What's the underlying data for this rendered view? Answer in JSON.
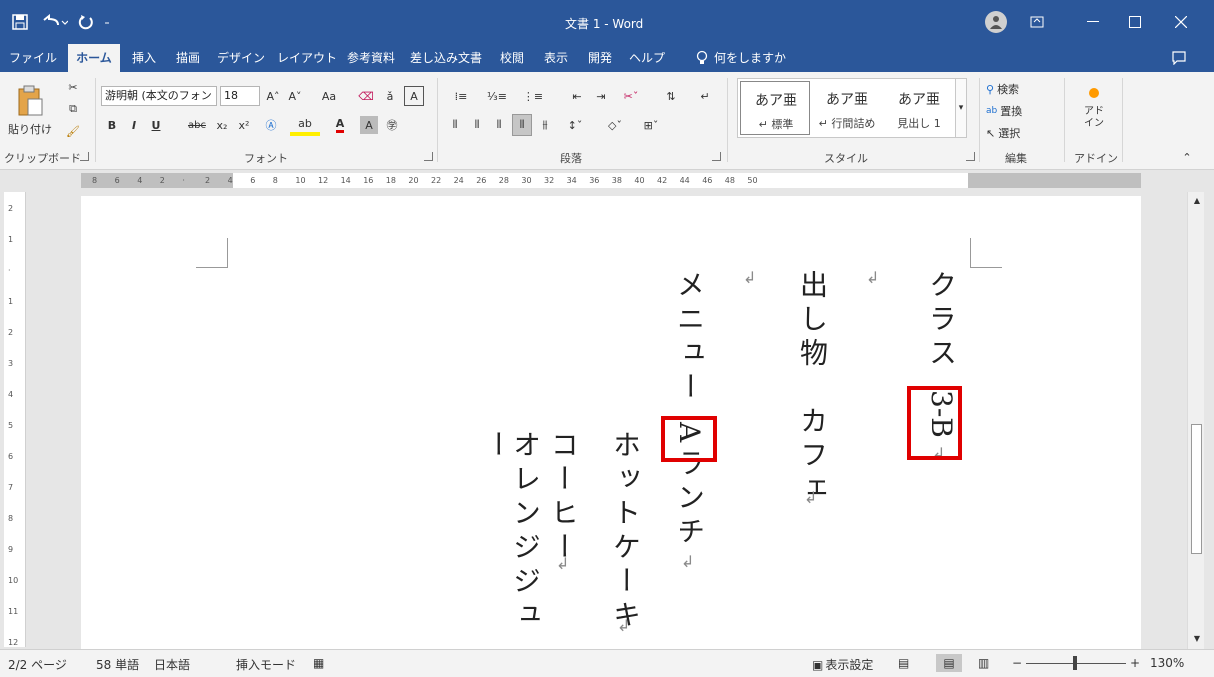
{
  "window": {
    "title": "文書 1  -  Word",
    "tell_me": "何をしますか"
  },
  "tabs": [
    "ファイル",
    "ホーム",
    "挿入",
    "描画",
    "デザイン",
    "レイアウト",
    "参考資料",
    "差し込み文書",
    "校閲",
    "表示",
    "開発",
    "ヘルプ"
  ],
  "ribbon": {
    "clipboard": {
      "paste": "貼り付け",
      "group": "クリップボード"
    },
    "font": {
      "name": "游明朝 (本文のフォン",
      "size": "18",
      "change_case": "Aa",
      "group": "フォント",
      "bold": "B",
      "italic": "I",
      "underline": "U",
      "strike": "abc",
      "sub": "x₂",
      "sup": "x²",
      "color_letter": "A"
    },
    "paragraph": {
      "group": "段落"
    },
    "styles": {
      "items": [
        {
          "main": "あア亜",
          "sub": "↵ 標準"
        },
        {
          "main": "あア亜",
          "sub": "↵ 行間詰め"
        },
        {
          "main": "あア亜",
          "sub": "見出し 1"
        }
      ],
      "group": "スタイル"
    },
    "editing": {
      "search": "検索",
      "replace": "置換",
      "select": "選択",
      "group": "編集"
    },
    "addins": {
      "label": "アド\nイン",
      "group": "アドイン"
    }
  },
  "ruler": {
    "ticks": [
      "8",
      "6",
      "4",
      "2",
      "",
      "2",
      "4",
      "6",
      "8",
      "10",
      "12",
      "14",
      "16",
      "18",
      "20",
      "22",
      "24",
      "26",
      "28",
      "30",
      "32",
      "34",
      "36",
      "38",
      "40",
      "42",
      "44",
      "46",
      "48",
      "50"
    ]
  },
  "vruler": {
    "ticks": [
      "2",
      "1",
      "",
      "1",
      "2",
      "3",
      "4",
      "5",
      "6",
      "7",
      "8",
      "9",
      "10",
      "11",
      "12"
    ]
  },
  "document": {
    "columns": [
      {
        "text": "クラス"
      },
      {
        "text": "3-B"
      },
      {
        "text": "出し物　カフェ"
      },
      {
        "text": "メニュー"
      },
      {
        "text": "Aランチ"
      },
      {
        "text": "ホットケーキ"
      },
      {
        "text": "コーヒー"
      },
      {
        "text": "オレンジジュー"
      }
    ]
  },
  "status": {
    "page": "2/2 ページ",
    "words": "58 単語",
    "lang": "日本語",
    "mode": "挿入モード",
    "display": "表示設定",
    "zoom": "130%"
  },
  "colors": {
    "accent": "#2b579a",
    "highlight": "#e00000"
  }
}
